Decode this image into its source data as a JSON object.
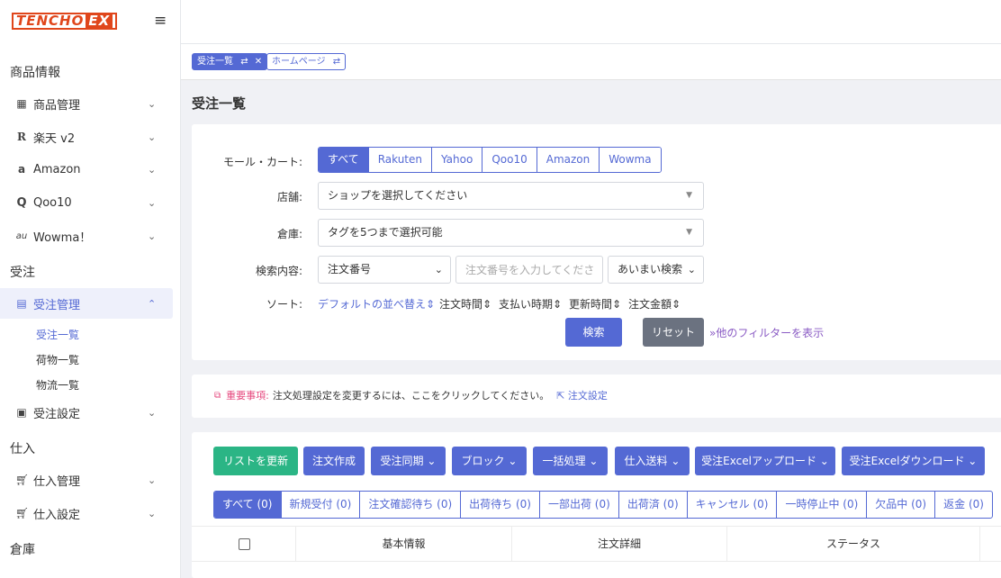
{
  "brand": {
    "logo_part1": "TENCHO",
    "logo_part2": "EX"
  },
  "sidebar": {
    "sections": {
      "products": "商品情報",
      "orders": "受注",
      "purchasing": "仕入",
      "warehouse": "倉庫"
    },
    "items": [
      {
        "label": "商品管理",
        "icon": "box-icon"
      },
      {
        "label": "楽天 v2",
        "icon": "rakuten-icon"
      },
      {
        "label": "Amazon",
        "icon": "amazon-icon"
      },
      {
        "label": "Qoo10",
        "icon": "qoo10-icon"
      },
      {
        "label": "Wowma！",
        "icon": "wowma-icon"
      },
      {
        "label": "受注管理",
        "icon": "clipboard-icon"
      },
      {
        "label": "受注設定",
        "icon": "settings-doc-icon"
      },
      {
        "label": "仕入管理",
        "icon": "cart-icon"
      },
      {
        "label": "仕入設定",
        "icon": "cart-settings-icon"
      }
    ],
    "order_sub": [
      "受注一覧",
      "荷物一覧",
      "物流一覧"
    ]
  },
  "page_tabs": [
    "受注一覧",
    "ホームページ"
  ],
  "page_title": "受注一覧",
  "filters": {
    "mall_label": "モール・カート:",
    "malls": [
      "すべて",
      "Rakuten",
      "Yahoo",
      "Qoo10",
      "Amazon",
      "Wowma"
    ],
    "shop_label": "店舗:",
    "shop_placeholder": "ショップを選択してください",
    "warehouse_label": "倉庫:",
    "warehouse_placeholder": "タグを5つまで選択可能",
    "search_label": "検索内容:",
    "search_field": "注文番号",
    "search_placeholder": "注文番号を入力してください",
    "match_mode": "あいまい検索",
    "sort_label": "ソート:",
    "sorts": [
      "デフォルトの並べ替え",
      "注文時間",
      "支払い時期",
      "更新時間",
      "注文金額"
    ],
    "search_button": "検索",
    "reset_button": "リセット",
    "more_filters": "他のフィルターを表示"
  },
  "notice": {
    "important": "重要事項:",
    "text": "注文処理設定を変更するには、ここをクリックしてください。",
    "link": "注文設定"
  },
  "actions": [
    "リストを更新",
    "注文作成",
    "受注同期",
    "ブロック",
    "一括処理",
    "仕入送料",
    "受注Excelアップロード",
    "受注Excelダウンロード"
  ],
  "status_tabs": [
    "すべて (0)",
    "新規受付 (0)",
    "注文確認待ち (0)",
    "出荷待ち (0)",
    "一部出荷 (0)",
    "出荷済 (0)",
    "キャンセル (0)",
    "一時停止中 (0)",
    "欠品中 (0)",
    "返金 (0)"
  ],
  "table": {
    "columns": [
      "基本情報",
      "注文詳細",
      "ステータス"
    ]
  },
  "colors": {
    "accent": "#5469d4",
    "brand": "#e0461b",
    "green": "#2bb585",
    "gray": "#6b7280",
    "important": "#e64a7f",
    "more_filter": "#8a5bc4"
  }
}
